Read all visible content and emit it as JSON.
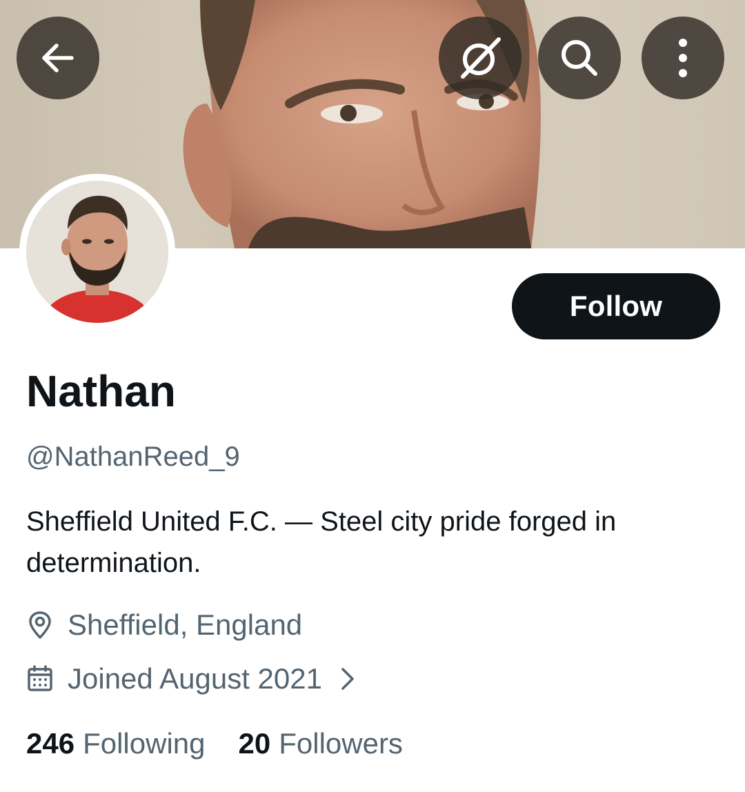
{
  "header": {
    "back_icon": "arrow-left-icon",
    "grok_icon": "grok-icon",
    "search_icon": "search-icon",
    "more_icon": "more-vertical-icon"
  },
  "profile": {
    "follow_label": "Follow",
    "name": "Nathan",
    "handle": "@NathanReed_9",
    "bio": "Sheffield United F.C. — Steel city pride forged in determination.",
    "location": "Sheffield, England",
    "joined": "Joined August 2021"
  },
  "stats": {
    "following_count": "246",
    "following_label": "Following",
    "followers_count": "20",
    "followers_label": "Followers"
  },
  "colors": {
    "text_primary": "#0f1419",
    "text_secondary": "#536471",
    "button_bg": "#0f1419",
    "avatar_shirt": "#d8322f"
  }
}
